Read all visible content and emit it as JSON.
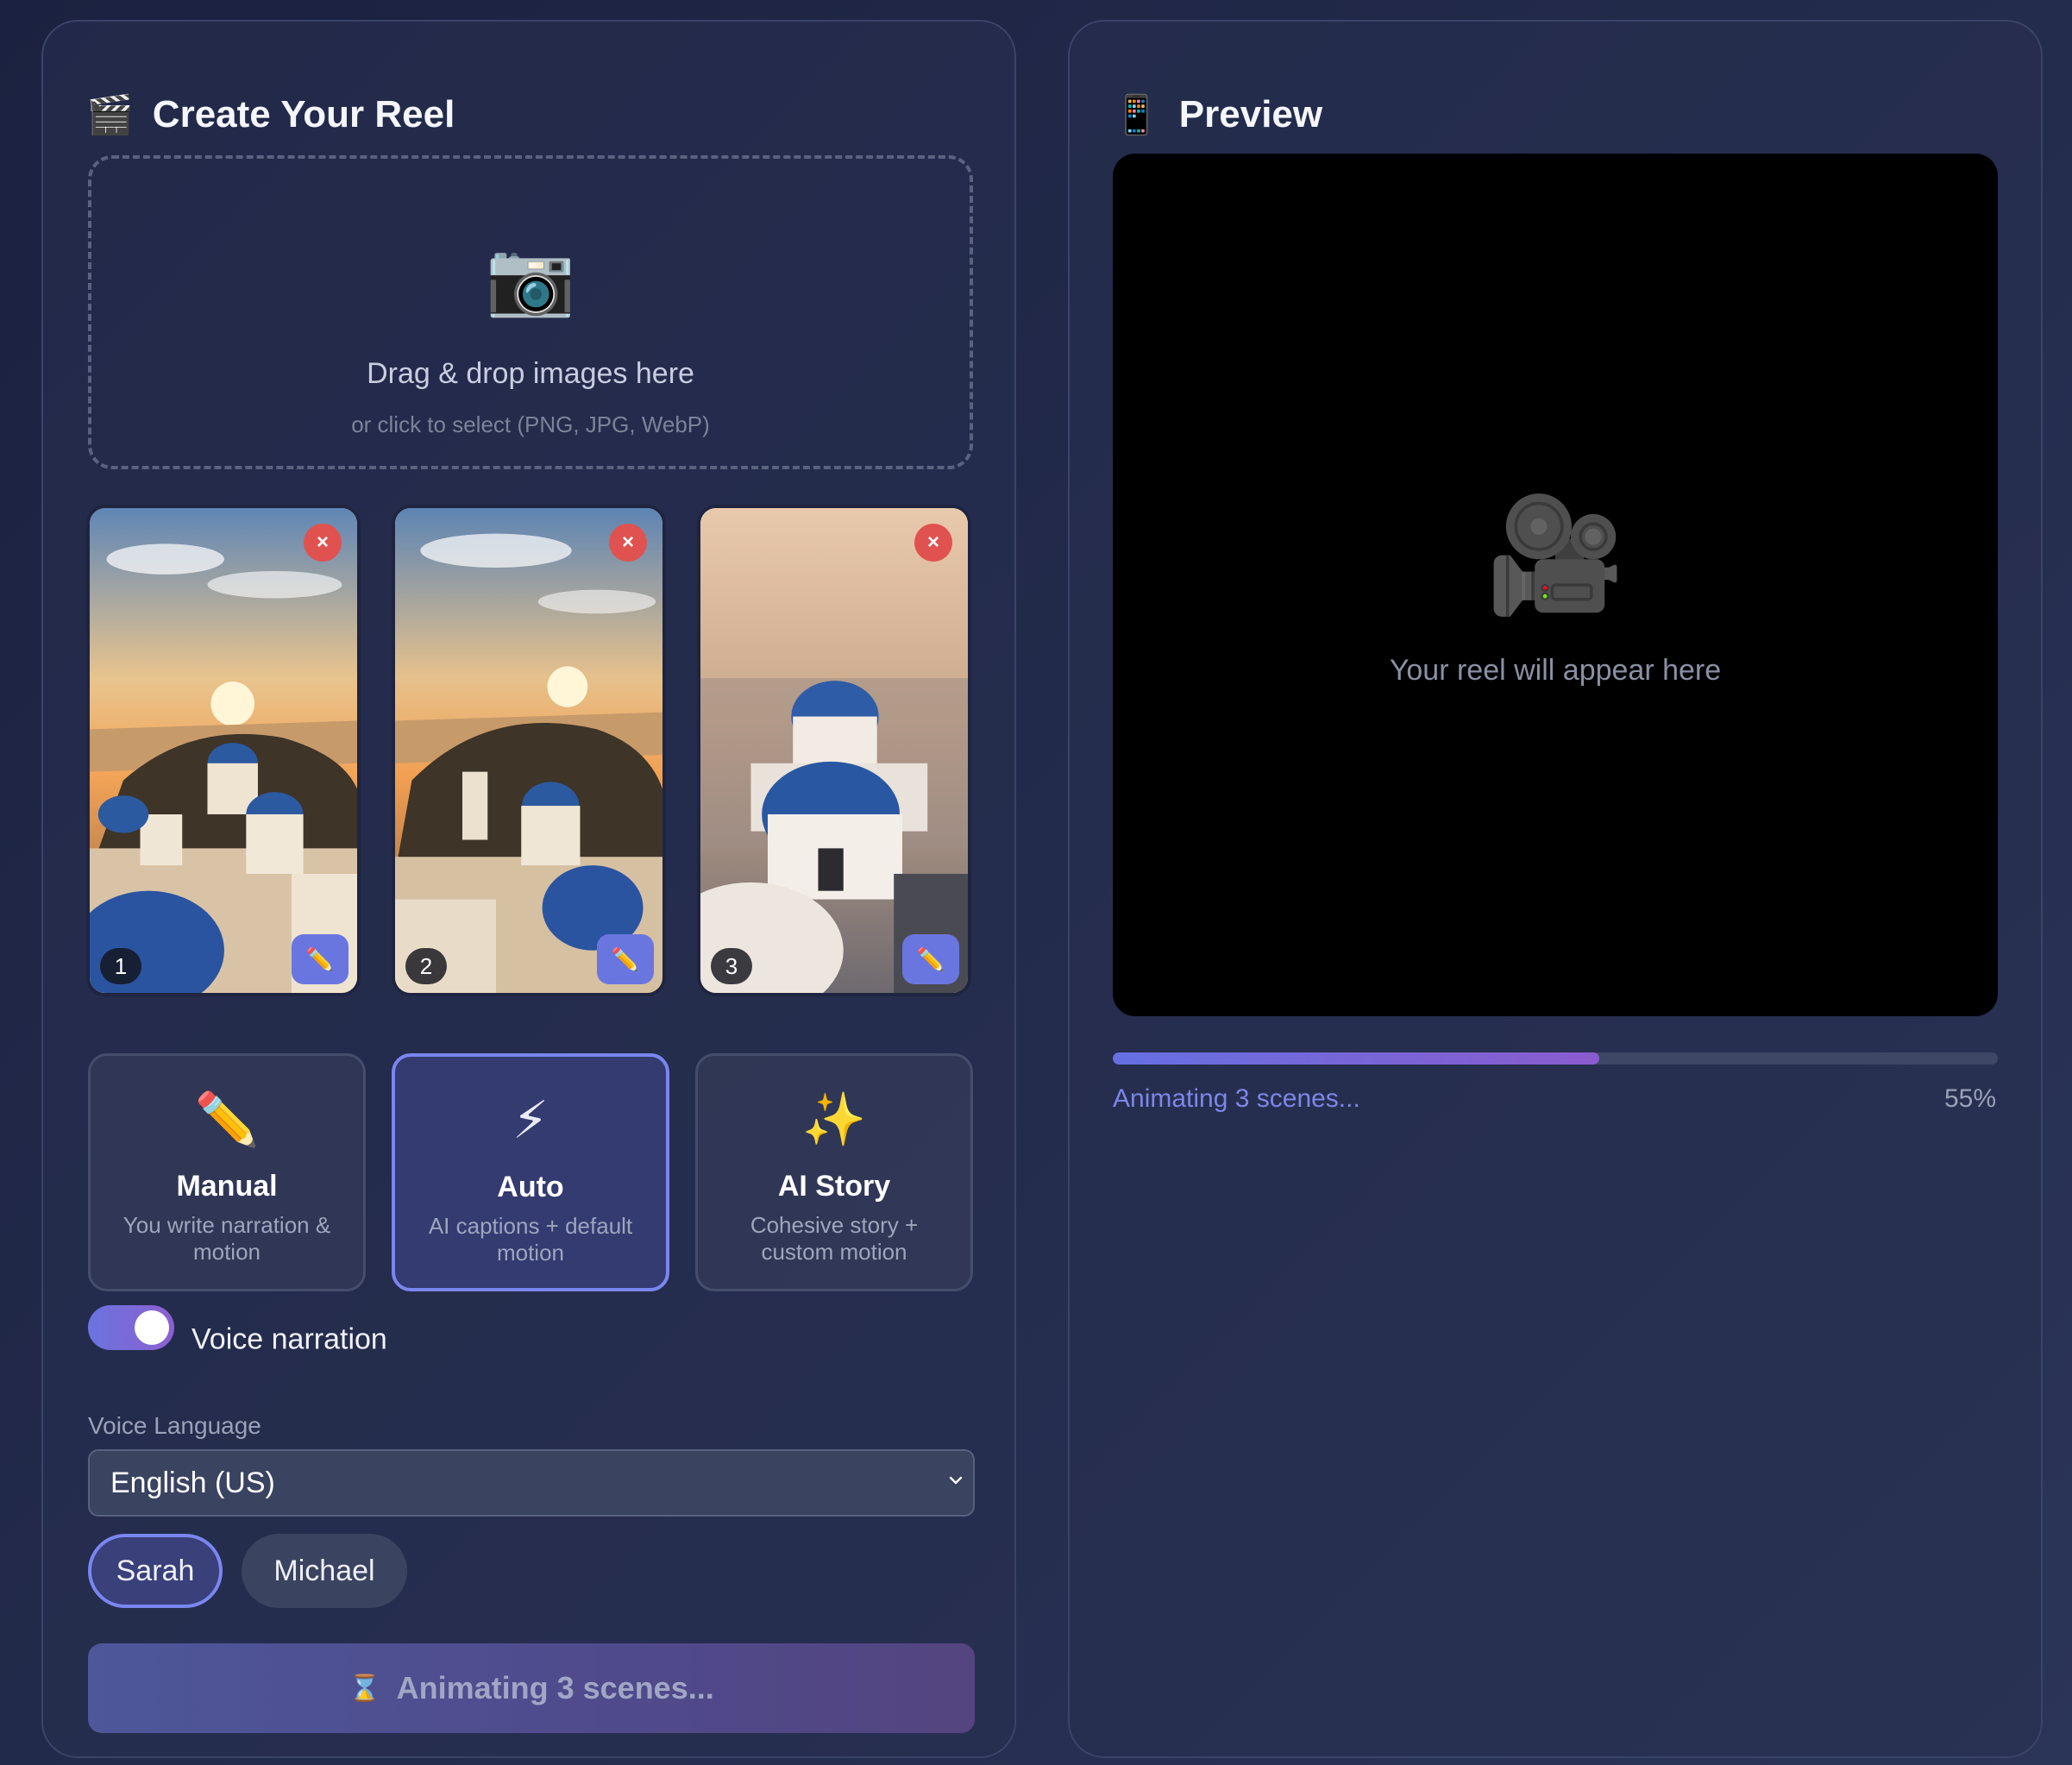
{
  "create": {
    "title": "Create Your Reel",
    "icon": "clapperboard-icon",
    "dropzone": {
      "icon": "camera-icon",
      "title": "Drag & drop images here",
      "subtitle": "or click to select (PNG, JPG, WebP)"
    },
    "images": [
      {
        "number": "1",
        "remove_label": "×",
        "edit_icon": "pencil-icon"
      },
      {
        "number": "2",
        "remove_label": "×",
        "edit_icon": "pencil-icon"
      },
      {
        "number": "3",
        "remove_label": "×",
        "edit_icon": "pencil-icon"
      }
    ],
    "modes": [
      {
        "icon_glyph": "✏️",
        "icon": "pencil-icon",
        "title": "Manual",
        "desc": "You write narration & motion",
        "selected": false
      },
      {
        "icon_glyph": "⚡",
        "icon": "lightning-icon",
        "title": "Auto",
        "desc": "AI captions + default motion",
        "selected": true
      },
      {
        "icon_glyph": "✨",
        "icon": "sparkles-icon",
        "title": "AI Story",
        "desc": "Cohesive story + custom motion",
        "selected": false
      }
    ],
    "voice_narration": {
      "label": "Voice narration",
      "enabled": true
    },
    "voice_language": {
      "label": "Voice Language",
      "selected": "English (US)"
    },
    "voices": [
      {
        "name": "Sarah",
        "selected": true
      },
      {
        "name": "Michael",
        "selected": false
      }
    ],
    "action_button": {
      "icon_glyph": "⌛",
      "label": "Animating 3 scenes..."
    }
  },
  "preview": {
    "title": "Preview",
    "icon": "mobile-phone-icon",
    "placeholder_icon": "movie-camera-icon",
    "placeholder_text": "Your reel will appear here",
    "progress": {
      "status": "Animating 3 scenes...",
      "percent_label": "55%",
      "percent": 55
    }
  },
  "colors": {
    "accent": "#6a74e0",
    "accent_purple": "#8c5fcf",
    "remove_red": "#e0524f",
    "background": "#1f2645"
  }
}
